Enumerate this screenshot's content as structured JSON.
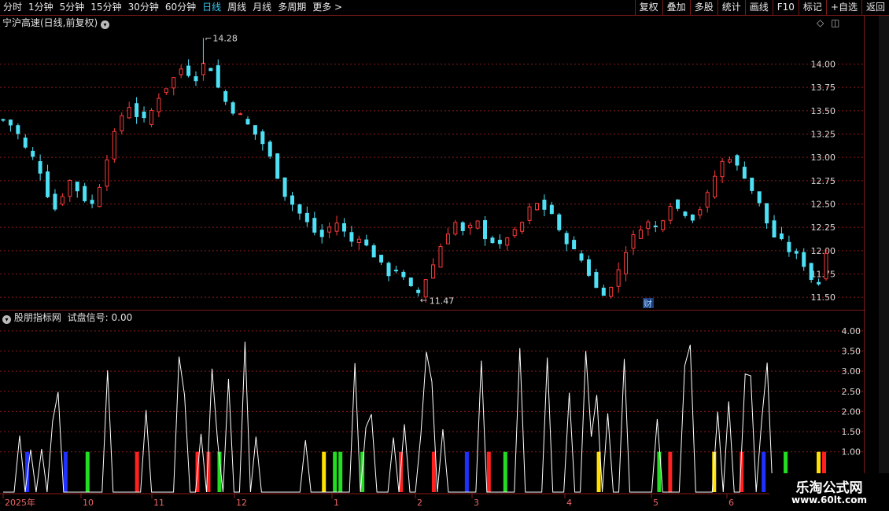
{
  "toolbar": {
    "periods": [
      "分时",
      "1分钟",
      "5分钟",
      "15分钟",
      "30分钟",
      "60分钟",
      "日线",
      "周线",
      "月线",
      "多周期",
      "更多 >"
    ],
    "active_period": "日线",
    "right_buttons": [
      "复权",
      "叠加",
      "多股",
      "统计",
      "画线",
      "F10",
      "标记",
      "+自选",
      "返回"
    ]
  },
  "main_panel": {
    "title": "宁沪高速(日线,前复权)",
    "high_label": "14.28",
    "low_label": "11.47",
    "event_badge": "财"
  },
  "indicator_panel": {
    "title": "股朋指标网",
    "signal_label": "试盘信号: 0.00"
  },
  "date_axis": [
    "2025年",
    "10",
    "11",
    "12",
    "1",
    "2",
    "3",
    "4",
    "5",
    "6"
  ],
  "watermark": {
    "line1": "乐淘公式网",
    "line2": "www.60lt.com"
  },
  "colors": {
    "up": "#ff3b3b",
    "down": "#4ee0f5",
    "grid": "#8b1a1a",
    "axis_text": "#d8d8d8"
  },
  "chart_data": [
    {
      "type": "candlestick",
      "title": "宁沪高速(日线,前复权)",
      "y_ticks": [
        11.5,
        11.75,
        12.0,
        12.25,
        12.5,
        12.75,
        13.0,
        13.25,
        13.5,
        13.75,
        14.0
      ],
      "ylim": [
        11.4,
        14.35
      ],
      "x_months": [
        "2025年",
        "10",
        "11",
        "12",
        "1",
        "2",
        "3",
        "4",
        "5",
        "6"
      ],
      "close_path": [
        13.4,
        13.35,
        13.25,
        13.1,
        13.0,
        12.85,
        12.6,
        12.45,
        12.6,
        12.75,
        12.65,
        12.55,
        12.5,
        12.7,
        13.0,
        13.25,
        13.45,
        13.55,
        13.45,
        13.4,
        13.5,
        13.65,
        13.75,
        13.85,
        13.95,
        13.9,
        13.85,
        14.0,
        13.95,
        13.75,
        13.6,
        13.5,
        13.45,
        13.35,
        13.25,
        13.15,
        13.0,
        12.8,
        12.6,
        12.5,
        12.4,
        12.3,
        12.2,
        12.15,
        12.25,
        12.3,
        12.2,
        12.1,
        12.15,
        12.05,
        11.95,
        11.85,
        11.75,
        11.8,
        11.7,
        11.6,
        11.55,
        11.7,
        11.85,
        12.05,
        12.2,
        12.3,
        12.2,
        12.25,
        12.3,
        12.15,
        12.1,
        12.05,
        12.15,
        12.2,
        12.3,
        12.45,
        12.5,
        12.45,
        12.4,
        12.2,
        12.1,
        12.0,
        11.9,
        11.75,
        11.6,
        11.55,
        11.6,
        11.8,
        12.0,
        12.15,
        12.25,
        12.3,
        12.25,
        12.35,
        12.5,
        12.45,
        12.4,
        12.35,
        12.45,
        12.6,
        12.8,
        12.95,
        13.0,
        12.9,
        12.8,
        12.65,
        12.5,
        12.3,
        12.15,
        12.1,
        12.0,
        11.95,
        11.85,
        11.7,
        11.65,
        12.0
      ]
    },
    {
      "type": "bar",
      "title": "股朋指标网 试盘信号",
      "y_ticks": [
        1.0,
        1.5,
        2.0,
        2.5,
        3.0,
        3.5,
        4.0
      ],
      "ylim": [
        0,
        4.25
      ],
      "current_value": 0.0,
      "signal_colors": [
        "#22dd22",
        "#ff2020",
        "#2030ff",
        "#ffe000",
        "#ffffff"
      ]
    }
  ]
}
